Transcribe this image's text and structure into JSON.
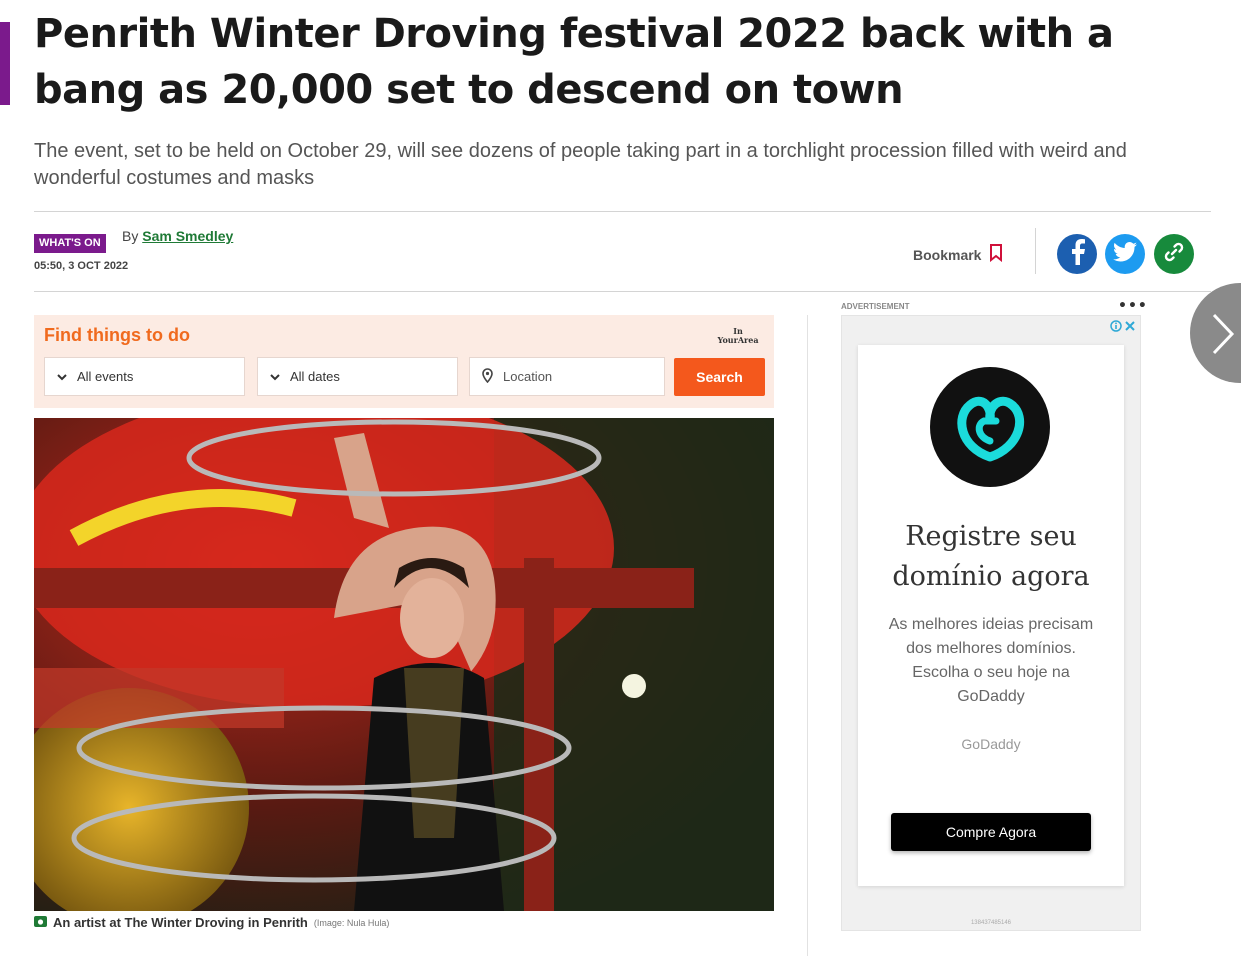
{
  "article": {
    "headline": "Penrith Winter Droving festival 2022 back with a bang as 20,000 set to descend on town",
    "standfirst": "The event, set to be held on October 29, will see dozens of people taking part in a torchlight procession filled with weird and wonderful costumes and masks",
    "section_badge": "WHAT'S ON",
    "byline_prefix": "By",
    "author": "Sam Smedley",
    "timestamp": "05:50, 3 OCT 2022",
    "bookmark_label": "Bookmark",
    "image_caption": "An artist at The Winter Droving in Penrith",
    "image_credit": "(Image: Nula Hula)"
  },
  "share": {
    "icons": [
      "facebook-icon",
      "twitter-icon",
      "link-icon"
    ]
  },
  "widget": {
    "title": "Find things to do",
    "logo_line1": "In",
    "logo_line2": "YourArea",
    "events_value": "All events",
    "dates_value": "All dates",
    "location_placeholder": "Location",
    "search_label": "Search"
  },
  "ad": {
    "label": "ADVERTISEMENT",
    "more": "•••",
    "headline_line1": "Registre seu",
    "headline_line2": "domínio agora",
    "body": "As melhores ideias precisam dos melhores domínios. Escolha o seu hoje na GoDaddy",
    "brand": "GoDaddy",
    "cta_label": "Compre Agora",
    "id_text": "1384374851​46"
  },
  "colors": {
    "accent_purple": "#7b1a8c",
    "author_green": "#1f7a36",
    "widget_orange": "#f4581c",
    "facebook": "#1c5fb0",
    "twitter": "#1d9bf0",
    "link_green": "#178a3c"
  }
}
